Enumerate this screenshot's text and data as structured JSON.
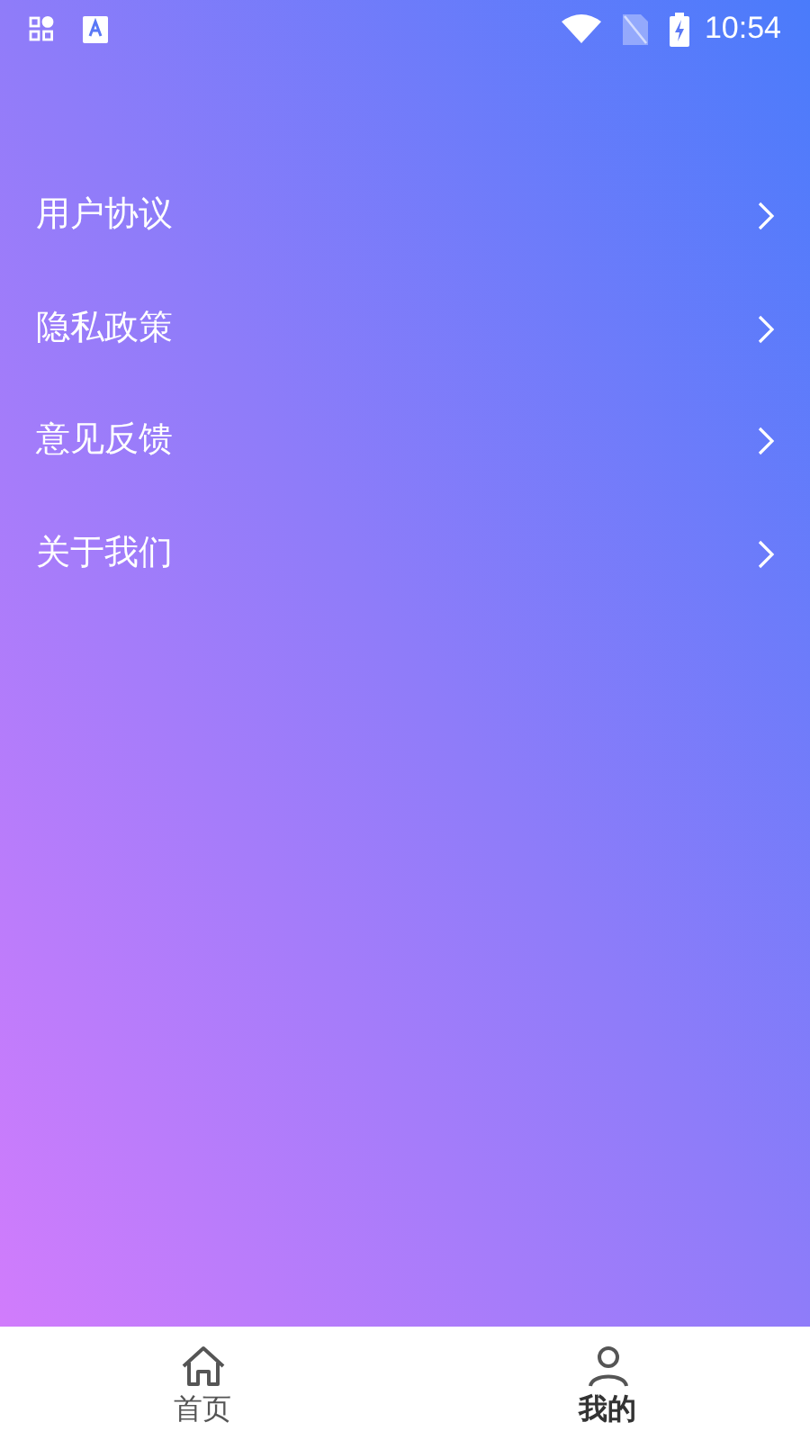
{
  "status_bar": {
    "time": "10:54"
  },
  "menu": [
    {
      "label": "用户协议"
    },
    {
      "label": "隐私政策"
    },
    {
      "label": "意见反馈"
    },
    {
      "label": "关于我们"
    }
  ],
  "tabs": [
    {
      "label": "首页",
      "kind": "home",
      "selected": false
    },
    {
      "label": "我的",
      "kind": "profile",
      "selected": true
    }
  ]
}
